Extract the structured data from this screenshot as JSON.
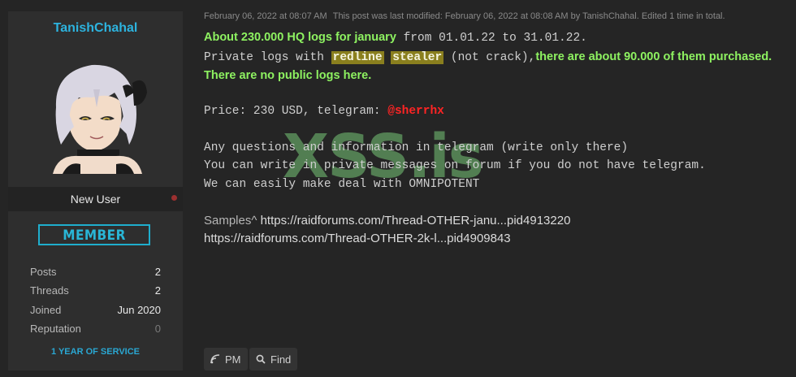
{
  "user": {
    "username": "TanishChahal",
    "rank": "New User",
    "badge": "MEMBER",
    "stats": [
      {
        "label": "Posts",
        "value": "2"
      },
      {
        "label": "Threads",
        "value": "2"
      },
      {
        "label": "Joined",
        "value": "Jun 2020"
      },
      {
        "label": "Reputation",
        "value": "0"
      }
    ],
    "service": "1 YEAR OF SERVICE",
    "avatar_icon": "anime-avatar"
  },
  "post": {
    "date": "February 06, 2022 at 08:07 AM",
    "modified": "This post was last modified: February 06, 2022 at 08:08 AM by TanishChahal. Edited 1 time in total.",
    "line1_hl": "About 230.000 HQ logs for january",
    "line1_rest": "from 01.01.22 to 31.01.22.",
    "line2_a": "Private logs with",
    "line2_tag1": "redline",
    "line2_tag2": "stealer",
    "line2_b": "(not crack),",
    "line2_hl": "there are about 90.000 of them purchased.",
    "line3_hl": "There are no public logs here.",
    "price_text": "Price: 230 USD, telegram:",
    "price_handle": "@sherrhx",
    "q1": "Any questions and information in telegram (write only there)",
    "q2": "You can write in private messages on forum if you do not have telegram.",
    "q3": "We can easily make deal with OMNIPOTENT",
    "samples_label": "Samples^",
    "sample1": "https://raidforums.com/Thread-OTHER-janu...pid4913220",
    "sample2": "https://raidforums.com/Thread-OTHER-2k-l...pid4909843",
    "watermark": "XSS.is"
  },
  "actions": {
    "pm": "PM",
    "find": "Find"
  },
  "colors": {
    "accent": "#2db3de",
    "highlight": "#8ef261",
    "red": "#ff2424"
  }
}
